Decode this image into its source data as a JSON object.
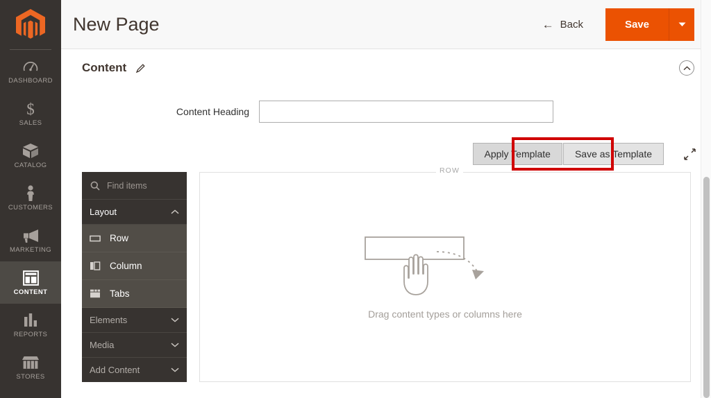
{
  "sidebar": {
    "logo_name": "magento-logo",
    "items": [
      {
        "label": "DASHBOARD",
        "icon": "dashboard-icon",
        "active": false
      },
      {
        "label": "SALES",
        "icon": "dollar-icon",
        "active": false
      },
      {
        "label": "CATALOG",
        "icon": "box-icon",
        "active": false
      },
      {
        "label": "CUSTOMERS",
        "icon": "person-icon",
        "active": false
      },
      {
        "label": "MARKETING",
        "icon": "megaphone-icon",
        "active": false
      },
      {
        "label": "CONTENT",
        "icon": "layout-icon",
        "active": true
      },
      {
        "label": "REPORTS",
        "icon": "bar-chart-icon",
        "active": false
      },
      {
        "label": "STORES",
        "icon": "store-icon",
        "active": false
      }
    ]
  },
  "header": {
    "title": "New Page",
    "back_label": "Back",
    "save_label": "Save",
    "save_caret_icon": "chevron-down-icon",
    "back_icon": "arrow-left-icon",
    "save_color": "#eb5202"
  },
  "section": {
    "title": "Content",
    "edit_icon": "pencil-icon",
    "collapse_icon": "chevron-up-icon"
  },
  "form": {
    "content_heading_label": "Content Heading",
    "content_heading_value": "",
    "content_heading_placeholder": ""
  },
  "template_toolbar": {
    "apply_label": "Apply Template",
    "save_as_label": "Save as Template",
    "expand_icon": "expand-fullscreen-icon",
    "focus_color": "#d00000",
    "focused_button": "Apply Template"
  },
  "panel": {
    "search_placeholder": "Find items",
    "search_value": "",
    "search_icon": "search-icon",
    "groups": [
      {
        "label": "Layout",
        "expanded": true,
        "chevron": "chevron-up-icon",
        "items": [
          {
            "label": "Row",
            "icon": "row-icon"
          },
          {
            "label": "Column",
            "icon": "column-icon"
          },
          {
            "label": "Tabs",
            "icon": "tabs-icon"
          }
        ]
      },
      {
        "label": "Elements",
        "expanded": false,
        "chevron": "chevron-down-icon",
        "items": []
      },
      {
        "label": "Media",
        "expanded": false,
        "chevron": "chevron-down-icon",
        "items": []
      },
      {
        "label": "Add Content",
        "expanded": false,
        "chevron": "chevron-down-icon",
        "items": []
      }
    ]
  },
  "stage": {
    "row_label": "ROW",
    "drop_text": "Drag content types or columns here",
    "drop_icon": "drag-hand-icon"
  }
}
